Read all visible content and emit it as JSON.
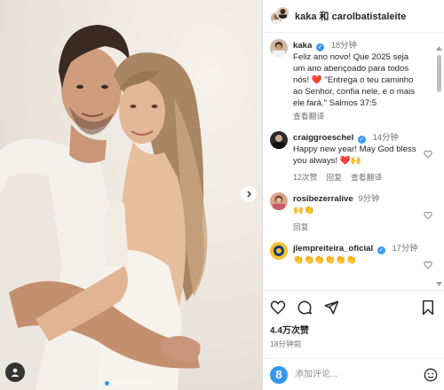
{
  "header": {
    "title": "kaka 和 carolbatistaleite"
  },
  "caption": {
    "username": "kaka",
    "time": "18分钟",
    "text": "Feliz ano novo! Que 2025 seja um ano abençoado para todos nós! ❤️ \"Entrega o teu caminho ao Senhor, confia nele, e o mais ele fará.\" Salmos 37:5",
    "translate": "查看翻译"
  },
  "comments": [
    {
      "username": "craiggroeschel",
      "verified": true,
      "time": "14分钟",
      "text": "Happy new year! May God bless you always! ❤️🙌",
      "likes": "12次赞",
      "reply": "回复",
      "translate": "查看翻译"
    },
    {
      "username": "rosibezerralive",
      "verified": false,
      "time": "9分钟",
      "text": "🙌👏",
      "reply": "回复"
    },
    {
      "username": "jlempreiteira_oficial",
      "verified": true,
      "time": "17分钟",
      "text": "👏👏👏👏👏👏"
    }
  ],
  "stats": {
    "likes": "4.4万次赞",
    "posted": "18分钟前"
  },
  "composer": {
    "avatar_letter": "8",
    "placeholder": "添加评论..."
  },
  "icons": {
    "like": "heart-icon",
    "comment": "comment-icon",
    "share": "share-icon",
    "save": "bookmark-icon",
    "emoji": "emoji-icon",
    "next": "chevron-right-icon",
    "tag": "user-tag-icon"
  },
  "colors": {
    "accent": "#3797f0",
    "heart": "#ed4956"
  }
}
